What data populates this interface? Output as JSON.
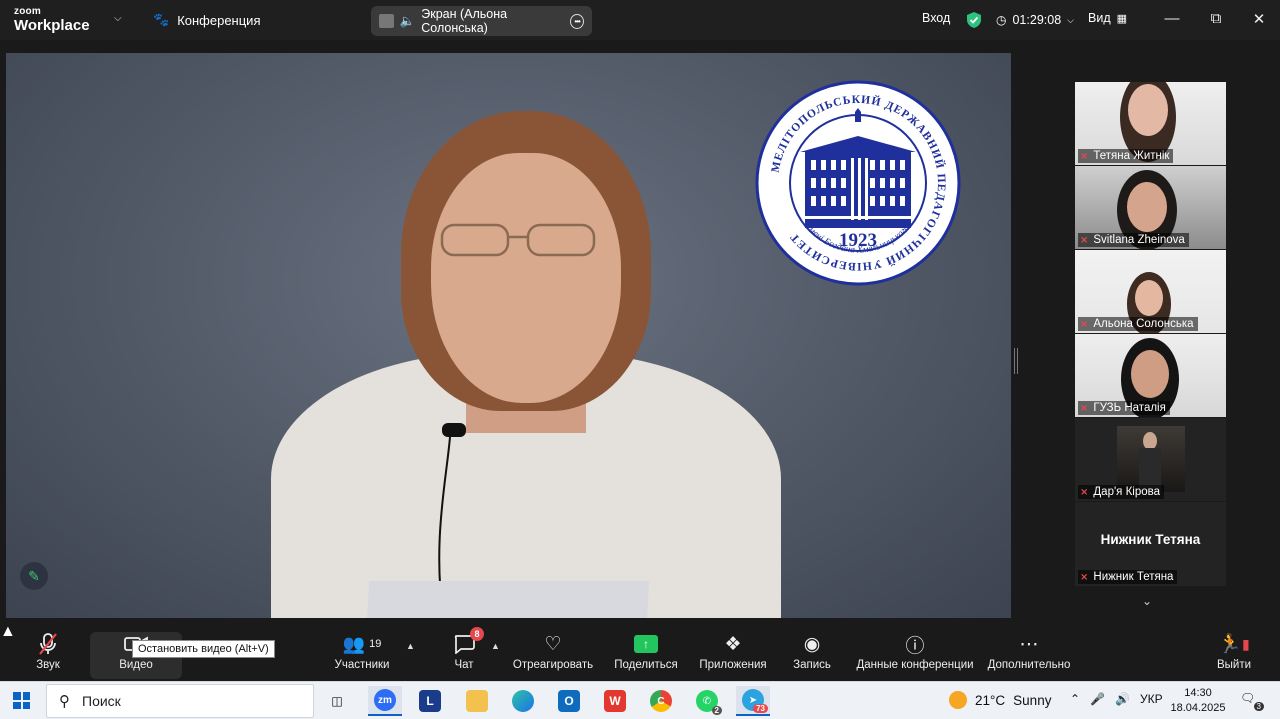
{
  "titlebar": {
    "brand_line1": "zoom",
    "brand_line2": "Workplace",
    "meeting_label": "Конференция",
    "screen_share_label": "Экран (Альона Солонська)",
    "signin_label": "Вход",
    "timer": "01:29:08",
    "view_label": "Вид"
  },
  "logo": {
    "ring_text": "МЕЛІТОПОЛЬСЬКИЙ ДЕРЖАВНИЙ ПЕДАГОГІЧНИЙ УНІВЕРСИТЕТ",
    "bottom_text": "імені Богдана Хмельницького",
    "year": "1923"
  },
  "participants": [
    {
      "name": "Тетяна Житнік",
      "muted": true,
      "active": false
    },
    {
      "name": "Svitlana Zheinova",
      "muted": true,
      "active": false
    },
    {
      "name": "Альона Солонська",
      "muted": true,
      "active": false
    },
    {
      "name": "ГУЗЬ Наталія",
      "muted": true,
      "active": true
    },
    {
      "name": "Дар'я Кірова",
      "muted": true,
      "active": false
    },
    {
      "name": "Нижник Тетяна",
      "muted": true,
      "active": false,
      "video_off": true
    }
  ],
  "toolbar": {
    "audio_label": "Звук",
    "video_label": "Видео",
    "video_tooltip": "Остановить видео (Alt+V)",
    "participants_label": "Участники",
    "participants_count": "19",
    "chat_label": "Чат",
    "chat_badge": "8",
    "react_label": "Отреагировать",
    "share_label": "Поделиться",
    "apps_label": "Приложения",
    "record_label": "Запись",
    "info_label": "Данные конференции",
    "more_label": "Дополнительно",
    "leave_label": "Выйти"
  },
  "taskbar": {
    "search_placeholder": "Поиск",
    "apps": [
      {
        "name": "task-view"
      },
      {
        "name": "zoom",
        "label": "zm"
      },
      {
        "name": "l-app",
        "label": "L"
      },
      {
        "name": "file-explorer"
      },
      {
        "name": "edge"
      },
      {
        "name": "outlook"
      },
      {
        "name": "wps",
        "label": "W"
      },
      {
        "name": "chrome",
        "label": "C"
      },
      {
        "name": "whatsapp",
        "badge": "2"
      },
      {
        "name": "telegram",
        "badge": "73"
      }
    ],
    "weather_temp": "21°C",
    "weather_text": "Sunny",
    "language": "УКР",
    "time": "14:30",
    "date": "18.04.2025",
    "notification_count": "3"
  },
  "colors": {
    "accent_green": "#2ec27e",
    "mute_red": "#e5484d",
    "logo_blue": "#1f2f9c"
  }
}
